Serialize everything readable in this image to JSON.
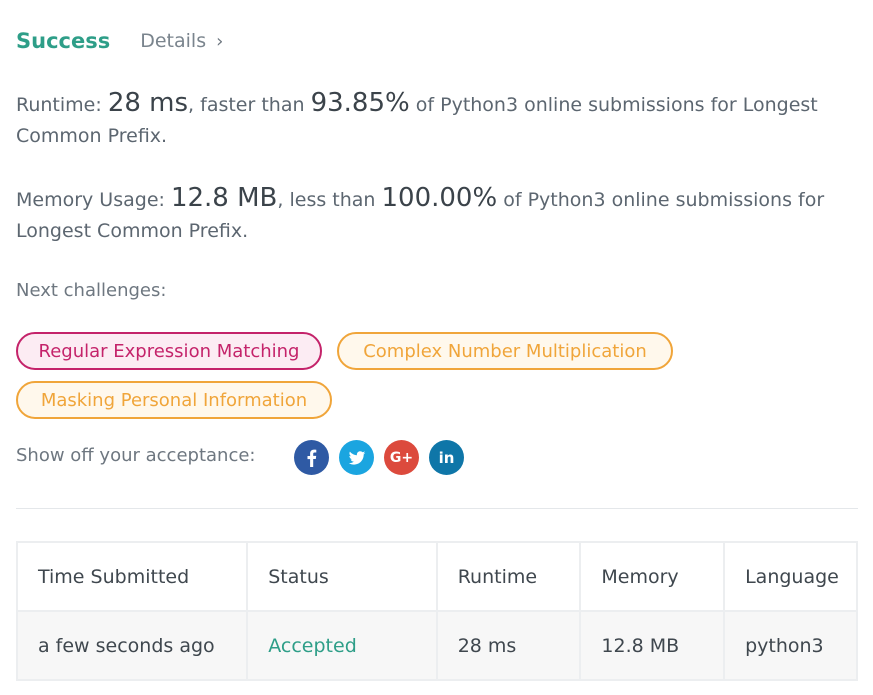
{
  "header": {
    "status": "Success",
    "details_label": "Details"
  },
  "runtime": {
    "label": "Runtime: ",
    "value": "28 ms",
    "comparison": ", faster than ",
    "percent": "93.85%",
    "suffix": " of Python3 online submissions for Longest Common Prefix."
  },
  "memory": {
    "label": "Memory Usage: ",
    "value": "12.8 MB",
    "comparison": ", less than ",
    "percent": "100.00%",
    "suffix": " of Python3 online submissions for Longest Common Prefix."
  },
  "next_challenges": {
    "label": "Next challenges:",
    "items": [
      {
        "title": "Regular Expression Matching",
        "difficulty": "hard",
        "color": "#c4236a"
      },
      {
        "title": "Complex Number Multiplication",
        "difficulty": "medium",
        "color": "#f0a53a"
      },
      {
        "title": "Masking Personal Information",
        "difficulty": "medium",
        "color": "#f0a53a"
      }
    ]
  },
  "share": {
    "label": "Show off your acceptance:",
    "icons": [
      "facebook-icon",
      "twitter-icon",
      "google-plus-icon",
      "linkedin-icon"
    ]
  },
  "table": {
    "headers": [
      "Time Submitted",
      "Status",
      "Runtime",
      "Memory",
      "Language"
    ],
    "rows": [
      [
        "a few seconds ago",
        "Accepted",
        "28 ms",
        "12.8 MB",
        "python3"
      ]
    ]
  },
  "colors": {
    "accent": "#2e9e88",
    "hard": "#c4236a",
    "medium": "#f0a53a"
  }
}
